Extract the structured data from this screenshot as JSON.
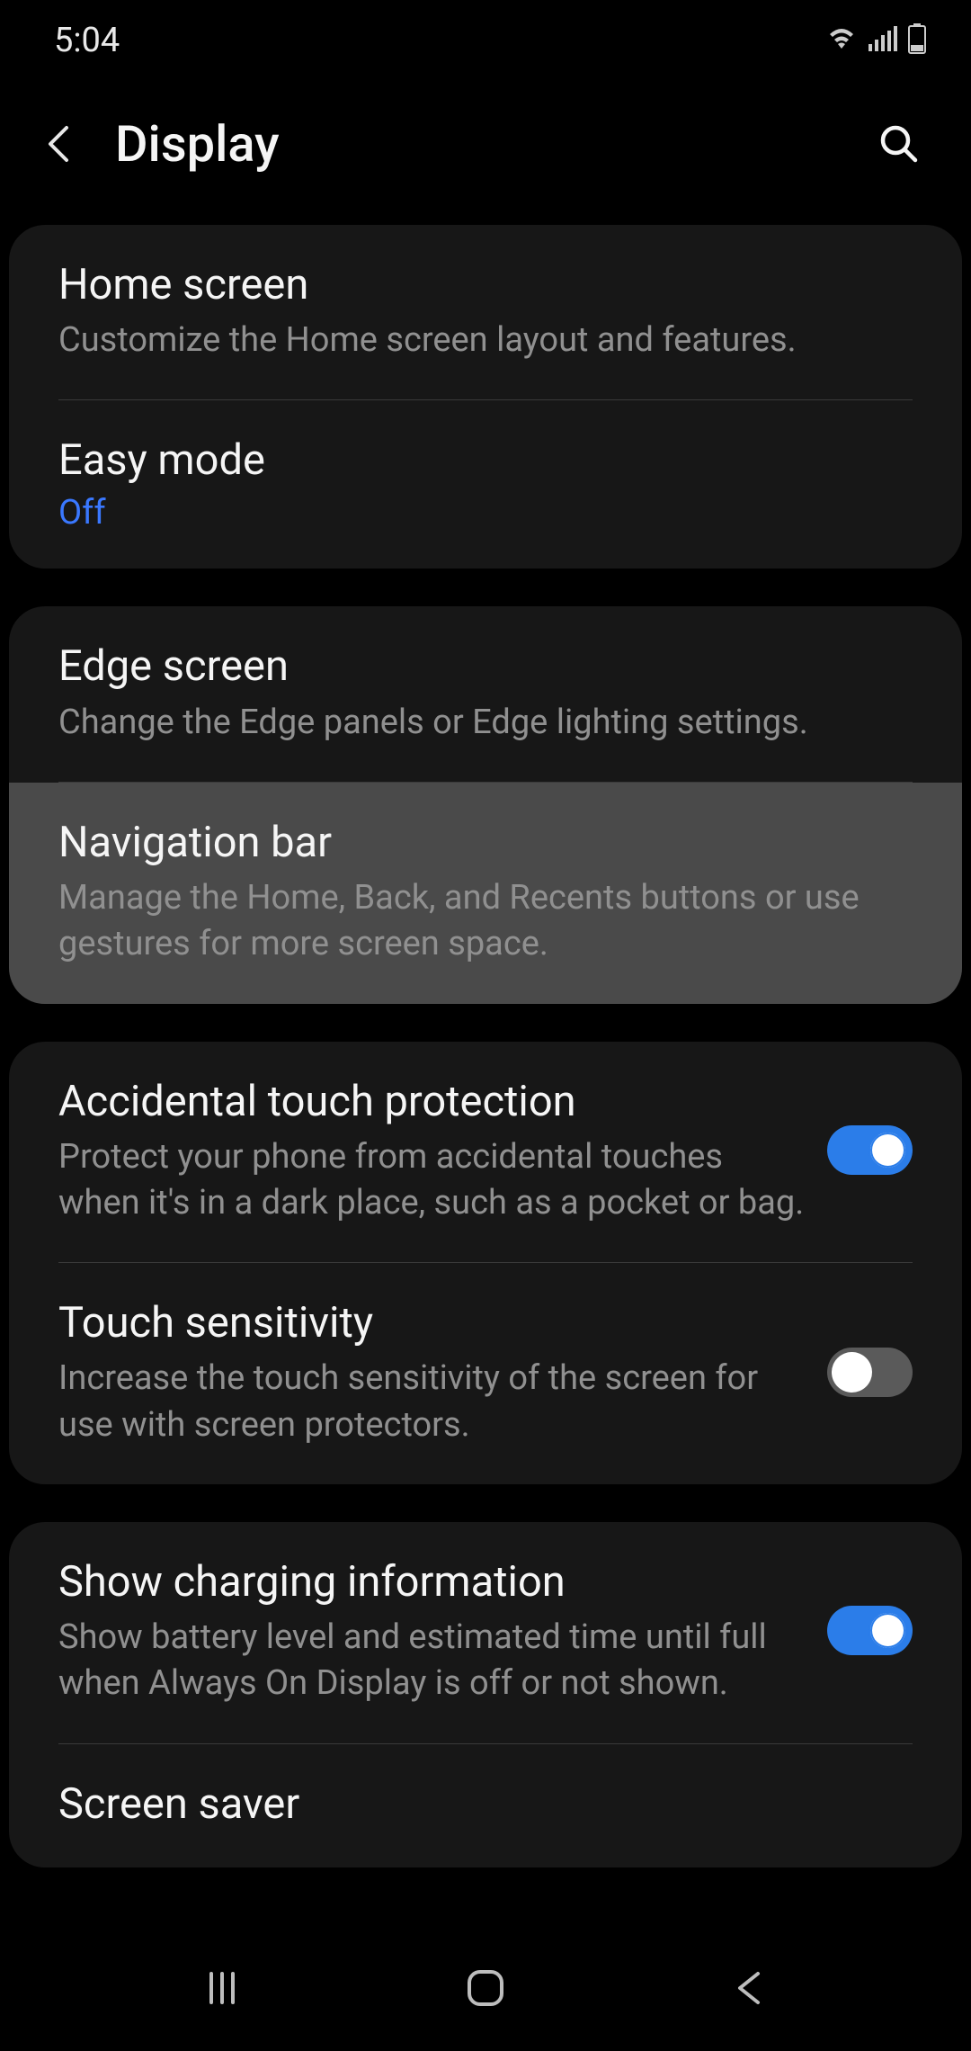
{
  "status": {
    "time": "5:04"
  },
  "header": {
    "title": "Display"
  },
  "groups": [
    {
      "rows": [
        {
          "id": "home-screen",
          "title": "Home screen",
          "subtitle": "Customize the Home screen layout and features."
        },
        {
          "id": "easy-mode",
          "title": "Easy mode",
          "status": "Off",
          "status_class": "status-off"
        }
      ]
    },
    {
      "rows": [
        {
          "id": "edge-screen",
          "title": "Edge screen",
          "subtitle": "Change the Edge panels or Edge lighting settings."
        },
        {
          "id": "navigation-bar",
          "title": "Navigation bar",
          "subtitle": "Manage the Home, Back, and Recents buttons or use gestures for more screen space.",
          "highlighted": true
        }
      ]
    },
    {
      "rows": [
        {
          "id": "accidental-touch",
          "title": "Accidental touch protection",
          "subtitle": "Protect your phone from accidental touches when it's in a dark place, such as a pocket or bag.",
          "toggle": true,
          "toggle_on": true
        },
        {
          "id": "touch-sensitivity",
          "title": "Touch sensitivity",
          "subtitle": "Increase the touch sensitivity of the screen for use with screen protectors.",
          "toggle": true,
          "toggle_on": false
        }
      ]
    },
    {
      "rows": [
        {
          "id": "show-charging",
          "title": "Show charging information",
          "subtitle": "Show battery level and estimated time until full when Always On Display is off or not shown.",
          "toggle": true,
          "toggle_on": true
        },
        {
          "id": "screen-saver",
          "title": "Screen saver"
        }
      ]
    }
  ]
}
